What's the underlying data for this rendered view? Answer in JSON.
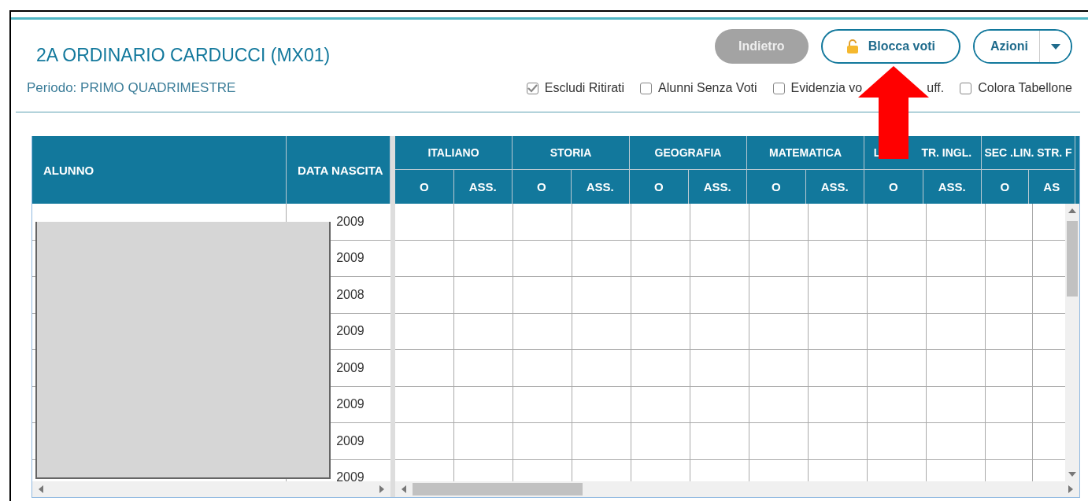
{
  "window": {
    "title": "2A ORDINARIO CARDUCCI (MX01)",
    "period": "Periodo: PRIMO QUADRIMESTRE"
  },
  "buttons": [
    {
      "label": "Indietro",
      "kind": "disabled"
    },
    {
      "label": "Blocca voti",
      "kind": "lock"
    },
    {
      "label": "Azioni",
      "kind": "split"
    }
  ],
  "filters": [
    {
      "label_parts": [
        "Escludi Ritirati"
      ],
      "checked": true
    },
    {
      "label_parts": [
        "Alunni Senza Voti"
      ],
      "checked": false
    },
    {
      "label_parts": [
        "Evidenzia vo",
        "uff."
      ],
      "checked": false
    },
    {
      "label_parts": [
        "Colora Tabellone"
      ],
      "checked": false
    }
  ],
  "table": {
    "columns": [
      "ALUNNO",
      "DATA NASCITA"
    ],
    "subjects": [
      {
        "label_parts": [
          "ITALIANO"
        ],
        "subcolumns": [
          "O",
          "ASS."
        ]
      },
      {
        "label_parts": [
          "STORIA"
        ],
        "subcolumns": [
          "O",
          "ASS."
        ]
      },
      {
        "label_parts": [
          "GEOGRAFIA"
        ],
        "subcolumns": [
          "O",
          "ASS."
        ]
      },
      {
        "label_parts": [
          "MATEMATICA"
        ],
        "subcolumns": [
          "O",
          "ASS."
        ]
      },
      {
        "label_parts": [
          "L",
          "TR. INGL."
        ],
        "subcolumns": [
          "O",
          "ASS."
        ]
      },
      {
        "label_parts": [
          "SEC .LIN. STR. F"
        ],
        "subcolumns": [
          "O",
          "AS"
        ]
      }
    ],
    "rows": [
      {
        "date": "2009"
      },
      {
        "date": "2009"
      },
      {
        "date": "2008"
      },
      {
        "date": "2009"
      },
      {
        "date": "2009"
      },
      {
        "date": "2009"
      },
      {
        "date": "2009"
      },
      {
        "date": "2009"
      }
    ]
  },
  "redaction_box": true,
  "arrow_annotation": true
}
